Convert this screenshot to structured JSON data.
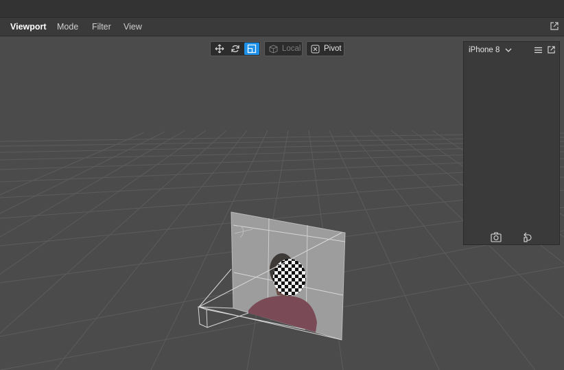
{
  "menubar": {
    "tabs": [
      {
        "label": "Viewport",
        "active": true
      },
      {
        "label": "Mode"
      },
      {
        "label": "Filter"
      },
      {
        "label": "View"
      }
    ],
    "popout_icon": "external-link-icon"
  },
  "toolbar": {
    "tools": [
      {
        "name": "move-tool",
        "icon": "move-arrows-icon",
        "active": false
      },
      {
        "name": "rotate-tool",
        "icon": "rotate-icon",
        "active": false
      },
      {
        "name": "scale-tool",
        "icon": "scale-icon",
        "active": true
      }
    ],
    "space_label": "Local",
    "space_enabled": false,
    "pivot_label": "Pivot"
  },
  "preview": {
    "device": "iPhone 8",
    "icons": [
      "chevron-down-icon",
      "menu-icon",
      "external-link-icon"
    ],
    "footer_icons": [
      "capture-icon",
      "reset-icon"
    ]
  },
  "colors": {
    "accent": "#1e90e8",
    "background": "#4b4b4b",
    "panel": "#3a3a3a"
  }
}
